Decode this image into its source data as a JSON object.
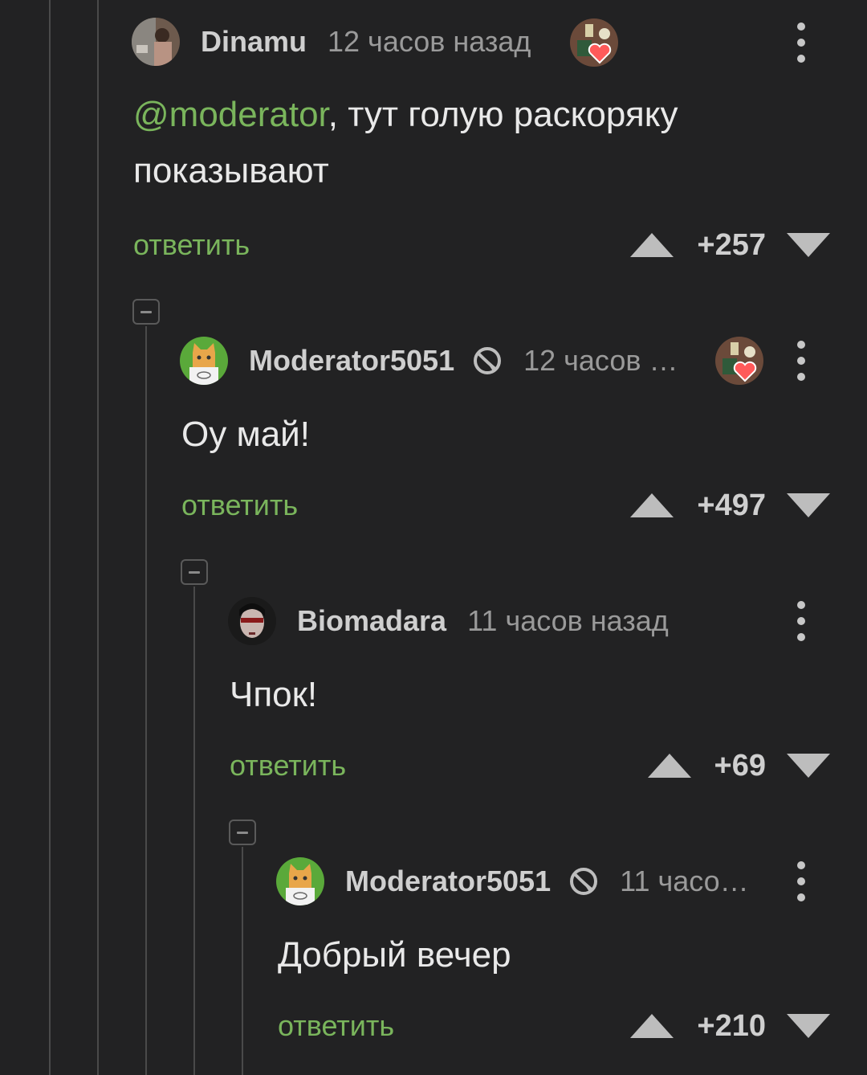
{
  "comments": [
    {
      "username": "Dinamu",
      "time": "12 часов назад",
      "mention": "@moderator",
      "text_after_mention": ", тут голую раскоряку",
      "text_line2": "показывают",
      "reply_label": "ответить",
      "score": "+257",
      "avatar_icon": "user-photo-avatar",
      "has_award": true
    },
    {
      "username": "Moderator5051",
      "time": "12 часов …",
      "text": "Оу май!",
      "reply_label": "ответить",
      "score": "+497",
      "avatar_icon": "cat-avatar",
      "has_moderator_badge": true,
      "has_award": true
    },
    {
      "username": "Biomadara",
      "time": "11 часов назад",
      "text": "Чпок!",
      "reply_label": "ответить",
      "score": "+69",
      "avatar_icon": "dark-face-avatar"
    },
    {
      "username": "Moderator5051",
      "time": "11 часо…",
      "text": "Добрый вечер",
      "reply_label": "ответить",
      "score": "+210",
      "avatar_icon": "cat-avatar",
      "has_moderator_badge": true
    }
  ],
  "colors": {
    "background": "#222223",
    "accent_green": "#7ab55c",
    "text": "#e9e9e9",
    "muted": "#9a9a9a"
  }
}
